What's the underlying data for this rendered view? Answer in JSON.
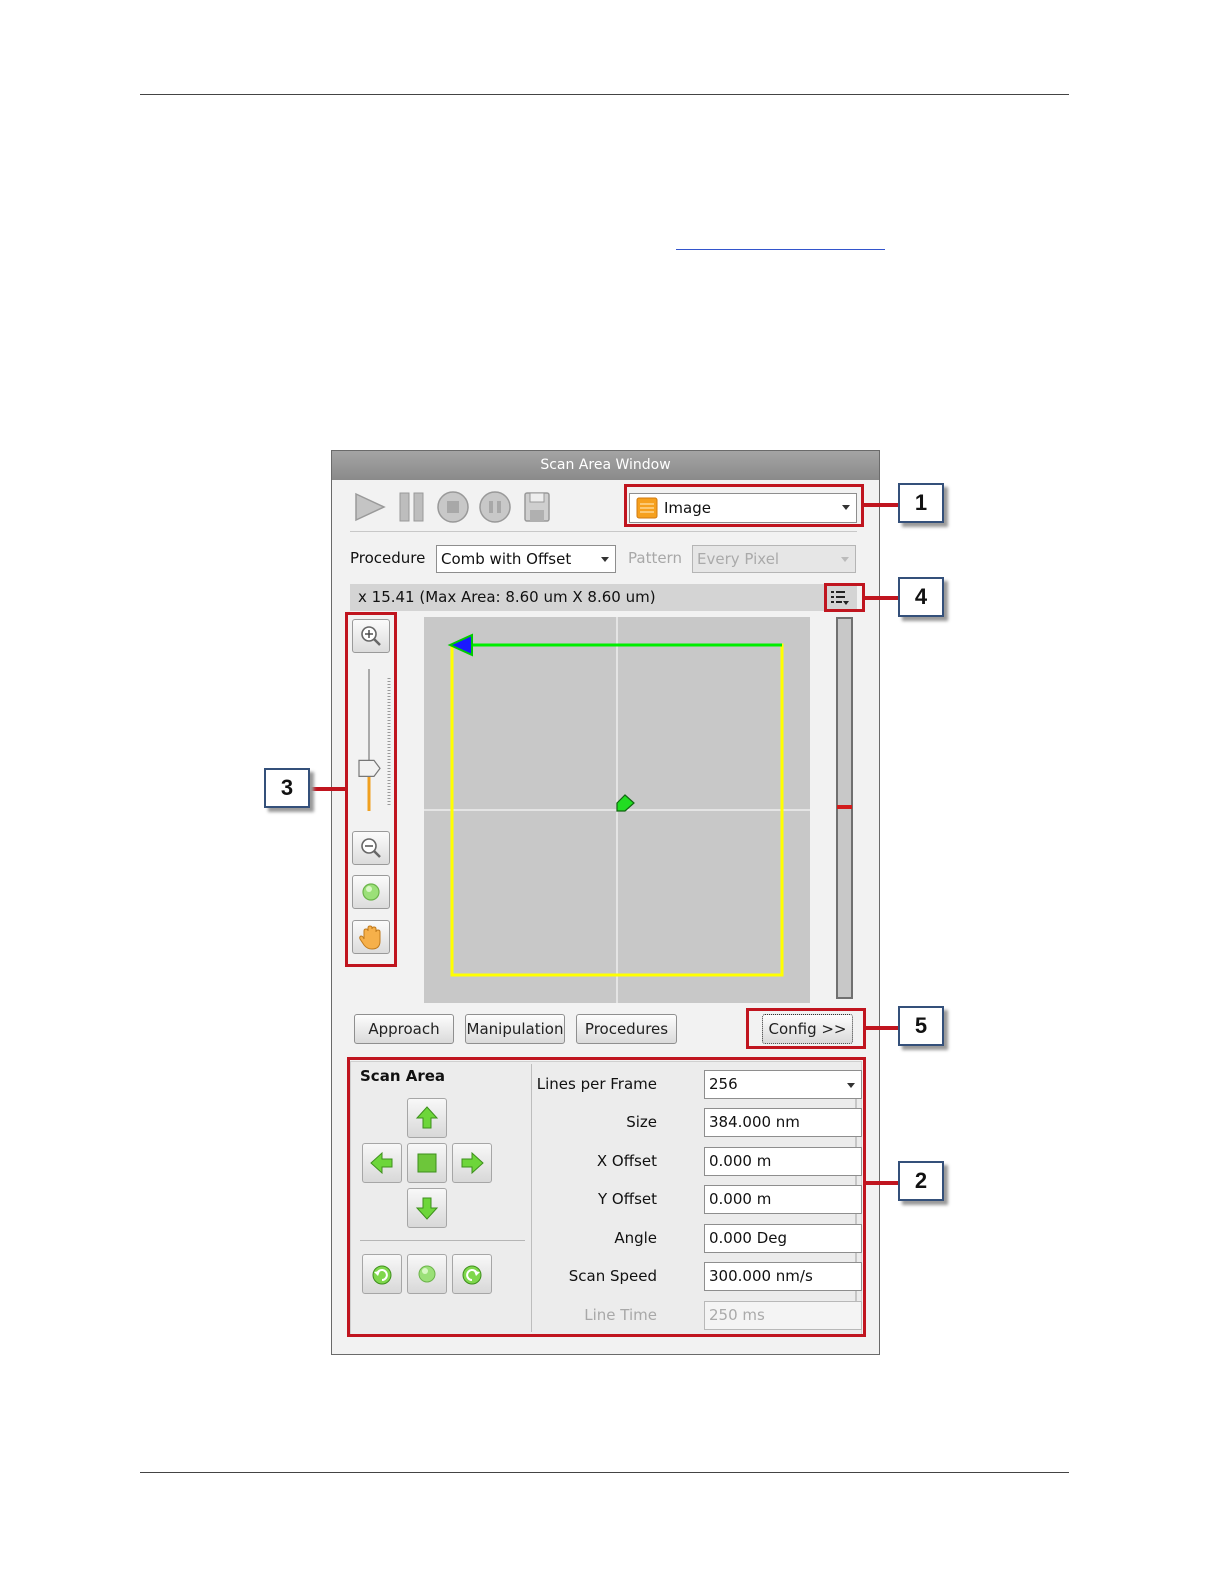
{
  "window": {
    "title": "Scan Area Window"
  },
  "toolbar": {
    "icons": [
      "play-icon",
      "pause-icon",
      "stop-icon",
      "stop-after-icon",
      "save-icon"
    ],
    "mode_select": {
      "value": "Image",
      "icon": "image-mode-icon"
    }
  },
  "procedure": {
    "label": "Procedure",
    "value": "Comb with Offset"
  },
  "pattern": {
    "label": "Pattern",
    "value": "Every Pixel",
    "disabled": true
  },
  "info": {
    "text": "x 15.41 (Max Area: 8.60 um X 8.60 um)",
    "menu_icon": "list-menu-icon"
  },
  "zoom_tools": {
    "icons": [
      "zoom-in-icon",
      "zoom-out-icon",
      "center-icon",
      "pan-hand-icon"
    ],
    "slider_level": 0.3
  },
  "view": {
    "scan_frame_color": "#ffff00",
    "scan_line_color": "#00ee00",
    "scan_start_marker_color": "#1a1aff",
    "crosshair_color": "#ffffff",
    "tip_color": "#22dd22"
  },
  "bottom_buttons": {
    "approach": "Approach",
    "manipulation": "Manipulation",
    "procedures": "Procedures",
    "config": "Config >>"
  },
  "scan_area": {
    "title": "Scan Area",
    "move_icons": [
      "arrow-up-icon",
      "arrow-left-icon",
      "center-stop-icon",
      "arrow-right-icon",
      "arrow-down-icon"
    ],
    "rotate_icons": [
      "rotate-ccw-icon",
      "reset-rotation-icon",
      "rotate-cw-icon"
    ],
    "fields": [
      {
        "label": "Lines per Frame",
        "value": "256",
        "dropdown": true
      },
      {
        "label": "Size",
        "value": "384.000 nm"
      },
      {
        "label": "X Offset",
        "value": "0.000  m"
      },
      {
        "label": "Y Offset",
        "value": "0.000  m"
      },
      {
        "label": "Angle",
        "value": "0.000  Deg"
      },
      {
        "label": "Scan Speed",
        "value": "300.000 nm/s"
      },
      {
        "label": "Line Time",
        "value": "250 ms",
        "disabled": true
      }
    ]
  },
  "callouts": [
    "1",
    "2",
    "3",
    "4",
    "5"
  ],
  "highlight_color": "#c0151f"
}
